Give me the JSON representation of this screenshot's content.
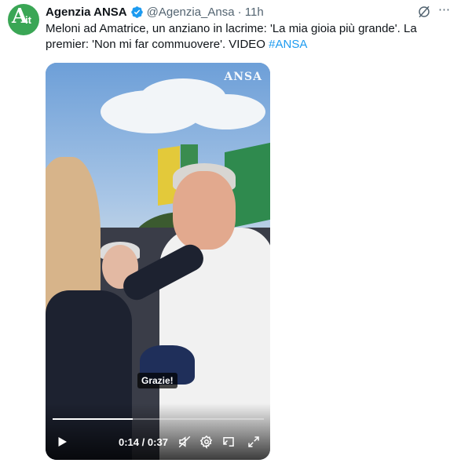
{
  "tweet": {
    "author_name": "Agenzia ANSA",
    "handle": "@Agenzia_Ansa",
    "time": "· 11h",
    "text": "Meloni ad Amatrice, un anziano in lacrime: 'La mia gioia più grande'. La premier: 'Non mi far commuovere'. VIDEO ",
    "hashtag": "#ANSA",
    "avatar_letter": "A",
    "avatar_suffix": "it"
  },
  "video": {
    "watermark": "ANSA",
    "subtitle": "Grazie!",
    "current_time": "0:14",
    "separator": "/",
    "duration": "0:37",
    "progress": 0.378
  },
  "icons": [
    "verified-badge-icon",
    "grok-icon",
    "more-icon",
    "play-icon",
    "muted-icon",
    "settings-icon",
    "pip-icon",
    "fullscreen-icon"
  ],
  "colors": {
    "accent": "#1d9bf0",
    "avatar_bg": "#3aa655",
    "text": "#0f1419",
    "muted": "#536471"
  }
}
